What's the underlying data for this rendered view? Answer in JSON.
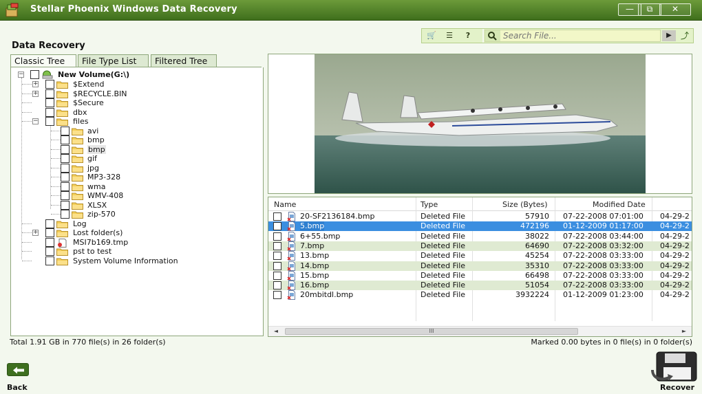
{
  "window": {
    "title": "Stellar Phoenix Windows Data Recovery",
    "minimize": "—",
    "restore": "⧉",
    "close": "✕"
  },
  "section_title": "Data Recovery",
  "toolbar": {
    "cart": "🛒",
    "report": "☰",
    "help": "?",
    "search_placeholder": "Search File...",
    "go": "▶",
    "export": "⤴"
  },
  "tabs": [
    "Classic Tree",
    "File Type List",
    "Filtered Tree"
  ],
  "tree": {
    "root": "New Volume(G:\\)",
    "items": [
      {
        "label": "$Extend",
        "expander": "+"
      },
      {
        "label": "$RECYCLE.BIN",
        "expander": "+"
      },
      {
        "label": "$Secure",
        "expander": ""
      },
      {
        "label": "dbx",
        "expander": ""
      },
      {
        "label": "files",
        "expander": "−"
      },
      {
        "label": "avi",
        "child": true
      },
      {
        "label": "bmp",
        "child": true
      },
      {
        "label": "bmp",
        "child": true,
        "highlight": true
      },
      {
        "label": "gif",
        "child": true
      },
      {
        "label": "jpg",
        "child": true
      },
      {
        "label": "MP3-328",
        "child": true
      },
      {
        "label": "wma",
        "child": true
      },
      {
        "label": "WMV-408",
        "child": true
      },
      {
        "label": "XLSX",
        "child": true
      },
      {
        "label": "zip-570",
        "child": true
      },
      {
        "label": "Log",
        "expander": ""
      },
      {
        "label": "Lost folder(s)",
        "expander": "+"
      },
      {
        "label": "MSI7b169.tmp",
        "expander": "",
        "file": true
      },
      {
        "label": "pst to test",
        "expander": ""
      },
      {
        "label": "System Volume Information",
        "expander": ""
      }
    ]
  },
  "list": {
    "headers": [
      "Name",
      "Type",
      "Size (Bytes)",
      "Modified Date",
      ""
    ],
    "rows": [
      {
        "name": "20-SF2136184.bmp",
        "type": "Deleted File",
        "size": "57910",
        "modified": "07-22-2008 07:01:00",
        "extra": "04-29-2"
      },
      {
        "name": "5.bmp",
        "type": "Deleted File",
        "size": "472196",
        "modified": "01-12-2009 01:17:00",
        "extra": "04-29-2"
      },
      {
        "name": "6+55.bmp",
        "type": "Deleted File",
        "size": "38022",
        "modified": "07-22-2008 03:44:00",
        "extra": "04-29-2"
      },
      {
        "name": "7.bmp",
        "type": "Deleted File",
        "size": "64690",
        "modified": "07-22-2008 03:32:00",
        "extra": "04-29-2"
      },
      {
        "name": "13.bmp",
        "type": "Deleted File",
        "size": "45254",
        "modified": "07-22-2008 03:33:00",
        "extra": "04-29-2"
      },
      {
        "name": "14.bmp",
        "type": "Deleted File",
        "size": "35310",
        "modified": "07-22-2008 03:33:00",
        "extra": "04-29-2"
      },
      {
        "name": "15.bmp",
        "type": "Deleted File",
        "size": "66498",
        "modified": "07-22-2008 03:33:00",
        "extra": "04-29-2"
      },
      {
        "name": "16.bmp",
        "type": "Deleted File",
        "size": "51054",
        "modified": "07-22-2008 03:33:00",
        "extra": "04-29-2"
      },
      {
        "name": "20mbitdl.bmp",
        "type": "Deleted File",
        "size": "3932224",
        "modified": "01-12-2009 01:23:00",
        "extra": "04-29-2"
      }
    ],
    "scroll_left": "◄",
    "scroll_right": "►",
    "scroll_grip": "III"
  },
  "status": {
    "left": "Total 1.91 GB in 770 file(s) in 26 folder(s)",
    "right": "Marked 0.00 bytes in 0 file(s) in 0 folder(s)"
  },
  "bottom": {
    "back_label": "Back",
    "recover_label": "Recover"
  }
}
